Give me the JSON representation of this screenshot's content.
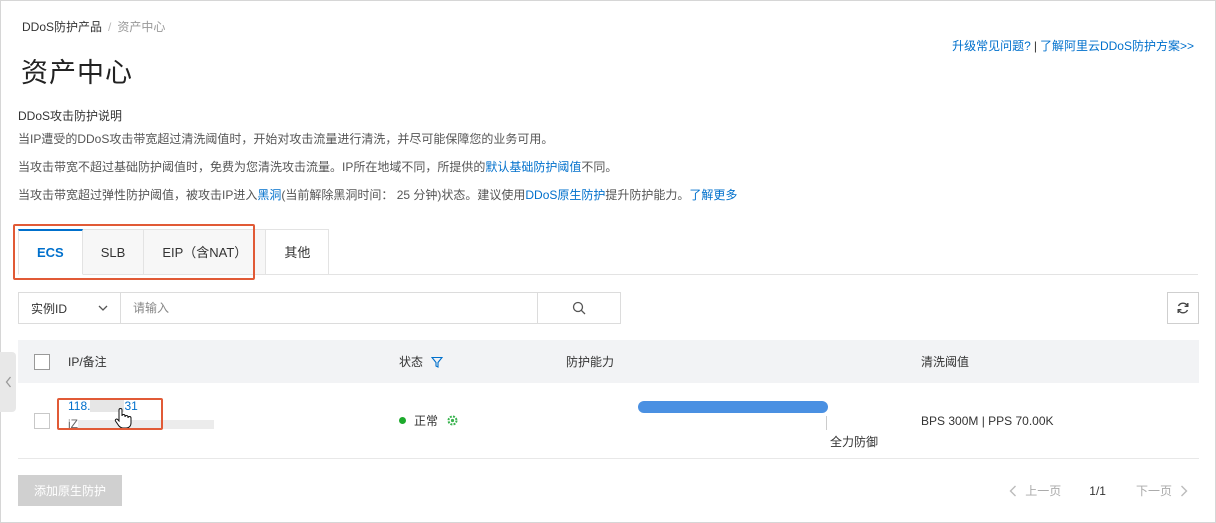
{
  "breadcrumb": {
    "root": "DDoS防护产品",
    "separator": "/",
    "current": "资产中心"
  },
  "page_title": "资产中心",
  "top_links": {
    "faq": "升级常见问题?",
    "pipe": "|",
    "learn": "了解阿里云DDoS防护方案>>"
  },
  "description": {
    "heading": "DDoS攻击防护说明",
    "line1": "当IP遭受的DDoS攻击带宽超过清洗阈值时，开始对攻击流量进行清洗，并尽可能保障您的业务可用。",
    "line2_pre": "当攻击带宽不超过基础防护阈值时，免费为您清洗攻击流量。IP所在地域不同，所提供的",
    "line2_link": "默认基础防护阈值",
    "line2_post": "不同。",
    "line3_a": "当攻击带宽超过弹性防护阈值，被攻击IP进入",
    "line3_link1": "黑洞",
    "line3_b": "(当前解除黑洞时间：  25 分钟)状态。建议使用",
    "line3_link2": "DDoS原生防护",
    "line3_c": "提升防护能力。",
    "line3_link3": "了解更多"
  },
  "tabs": [
    {
      "label": "ECS",
      "active": true
    },
    {
      "label": "SLB",
      "active": false
    },
    {
      "label": "EIP（含NAT）",
      "active": false
    },
    {
      "label": "其他",
      "active": false
    }
  ],
  "search": {
    "select_value": "实例ID",
    "placeholder": "请输入",
    "search_icon": "search-icon"
  },
  "table": {
    "headers": {
      "ip": "IP/备注",
      "status": "状态",
      "capacity": "防护能力",
      "threshold": "清洗阈值"
    },
    "rows": [
      {
        "ip_prefix": "118.",
        "ip_suffix": "31",
        "note_prefix": "iZ",
        "status": "正常",
        "capacity_level": 1.0,
        "capacity_label": "全力防御",
        "threshold": "BPS 300M | PPS 70.00K"
      }
    ]
  },
  "footer": {
    "add_button": "添加原生防护",
    "prev": "上一页",
    "page": "1/1",
    "next": "下一页"
  },
  "colors": {
    "accent": "#0070cc",
    "status_ok": "#1daa2c",
    "highlight": "#e15a36",
    "bar": "#4a90e2"
  }
}
